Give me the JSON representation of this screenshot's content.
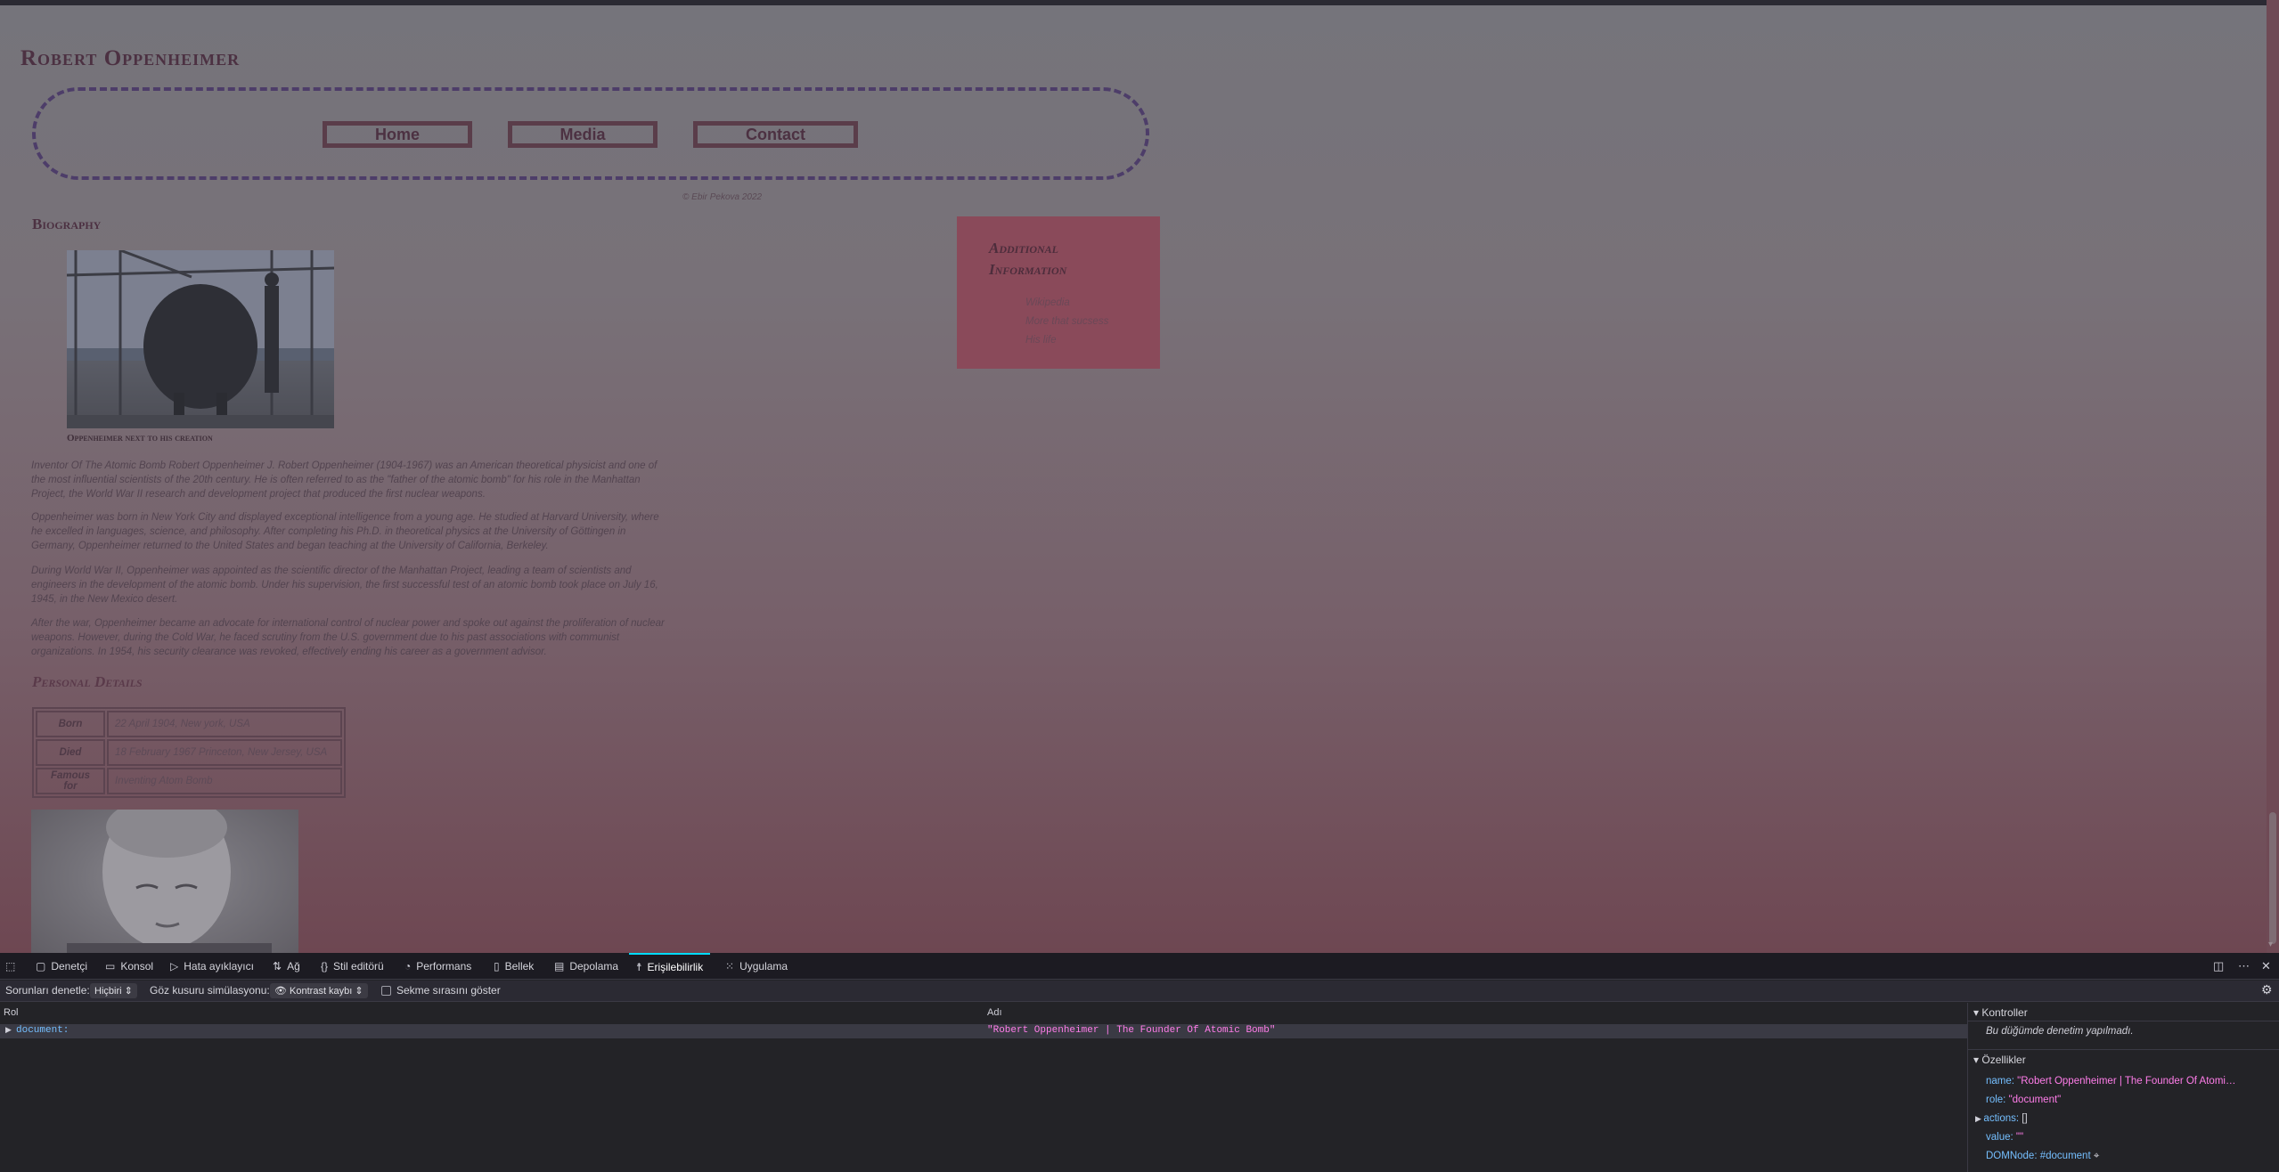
{
  "site": {
    "title": "Robert Oppenheimer",
    "nav": [
      "Home",
      "Media",
      "Contact"
    ],
    "copyright": "© Ebir Pekova 2022",
    "biography_heading": "Biography",
    "photo_caption": "Oppenheimer next to his creation",
    "paragraphs": [
      "Inventor Of The Atomic Bomb Robert Oppenheimer J. Robert Oppenheimer (1904-1967) was an American theoretical physicist and one of the most influential scientists of the 20th century. He is often referred to as the \"father of the atomic bomb\" for his role in the Manhattan Project, the World War II research and development project that produced the first nuclear weapons.",
      "Oppenheimer was born in New York City and displayed exceptional intelligence from a young age. He studied at Harvard University, where he excelled in languages, science, and philosophy. After completing his Ph.D. in theoretical physics at the University of Göttingen in Germany, Oppenheimer returned to the United States and began teaching at the University of California, Berkeley.",
      "During World War II, Oppenheimer was appointed as the scientific director of the Manhattan Project, leading a team of scientists and engineers in the development of the atomic bomb. Under his supervision, the first successful test of an atomic bomb took place on July 16, 1945, in the New Mexico desert.",
      "After the war, Oppenheimer became an advocate for international control of nuclear power and spoke out against the proliferation of nuclear weapons. However, during the Cold War, he faced scrutiny from the U.S. government due to his past associations with communist organizations. In 1954, his security clearance was revoked, effectively ending his career as a government advisor."
    ],
    "personal_heading": "Personal Details",
    "details": [
      {
        "key": "Born",
        "value": "22 April 1904, New york, USA"
      },
      {
        "key": "Died",
        "value": "18 February 1967 Princeton, New Jersey, USA"
      },
      {
        "key": "Famous for",
        "value": "Inventing Atom Bomb"
      }
    ],
    "aside": {
      "heading": "Additional Information",
      "links": [
        "Wikipedia",
        "More that sucsess",
        "His life"
      ]
    }
  },
  "devtools": {
    "tabs": [
      {
        "label": "Denetçi",
        "icon": "inspector-icon"
      },
      {
        "label": "Konsol",
        "icon": "console-icon"
      },
      {
        "label": "Hata ayıklayıcı",
        "icon": "debugger-icon"
      },
      {
        "label": "Ağ",
        "icon": "network-icon"
      },
      {
        "label": "Stil editörü",
        "icon": "style-editor-icon"
      },
      {
        "label": "Performans",
        "icon": "performance-icon"
      },
      {
        "label": "Bellek",
        "icon": "memory-icon"
      },
      {
        "label": "Depolama",
        "icon": "storage-icon"
      },
      {
        "label": "Erişilebilirlik",
        "icon": "accessibility-icon"
      },
      {
        "label": "Uygulama",
        "icon": "application-icon"
      }
    ],
    "active_tab": "Erişilebilirlik",
    "toolbar": {
      "check_issues_label": "Sorunları denetle:",
      "check_issues_value": "Hiçbiri",
      "simulate_label": "Göz kusuru simülasyonu:",
      "simulate_value": "Kontrast kaybı",
      "tab_order_label": "Sekme sırasını göster"
    },
    "columns": {
      "role": "Rol",
      "name": "Adı"
    },
    "tree": [
      {
        "role": "document:",
        "name": "\"Robert Oppenheimer | The Founder Of Atomic Bomb\""
      }
    ],
    "sidebar": {
      "checks_heading": "Kontroller",
      "checks_message": "Bu düğümde denetim yapılmadı.",
      "properties_heading": "Özellikler",
      "properties": [
        {
          "key": "name:",
          "value": "\"Robert Oppenheimer | The Founder Of Atomi…"
        },
        {
          "key": "role:",
          "value": "\"document\""
        },
        {
          "key": "actions:",
          "value": "[]"
        },
        {
          "key": "value:",
          "value": "\"\""
        },
        {
          "key": "DOMNode:",
          "value": "#document"
        }
      ]
    }
  }
}
